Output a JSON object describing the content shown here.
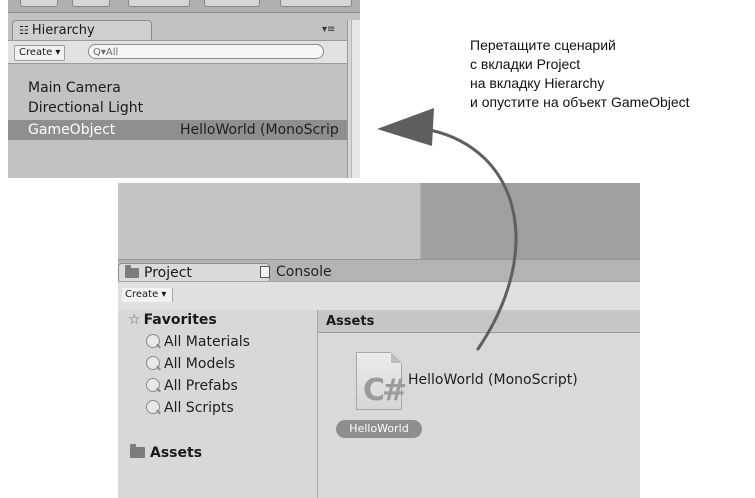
{
  "hierarchy": {
    "tab_label": "Hierarchy",
    "tab_icon": "list-icon",
    "menu_glyph": "▾≡",
    "create_label": "Create ▾",
    "search_placeholder": "Q▾All",
    "items": [
      {
        "name": "Main Camera"
      },
      {
        "name": "Directional Light"
      },
      {
        "name": "GameObject",
        "script": "HelloWorld (MonoScrip",
        "selected": true
      }
    ]
  },
  "instruction": {
    "lines": [
      "Перетащите сценарий",
      "с вкладки Project",
      "на вкладку Hierarchy",
      "и опустите на объект GameObject"
    ]
  },
  "project": {
    "tab_project": "Project",
    "tab_console": "Console",
    "create_label": "Create ▾",
    "favorites_label": "Favorites",
    "favorites": [
      "All Materials",
      "All Models",
      "All Prefabs",
      "All Scripts"
    ],
    "assets_folder": "Assets",
    "assets_header": "Assets",
    "file_icon_text": "C#",
    "asset_name": "HelloWorld",
    "drag_label": "HelloWorld (MonoScript)"
  },
  "colors": {
    "selection_row": "#8f8f8f",
    "panel_bg": "#c4c4c4",
    "arrow": "#5f5f5f"
  }
}
